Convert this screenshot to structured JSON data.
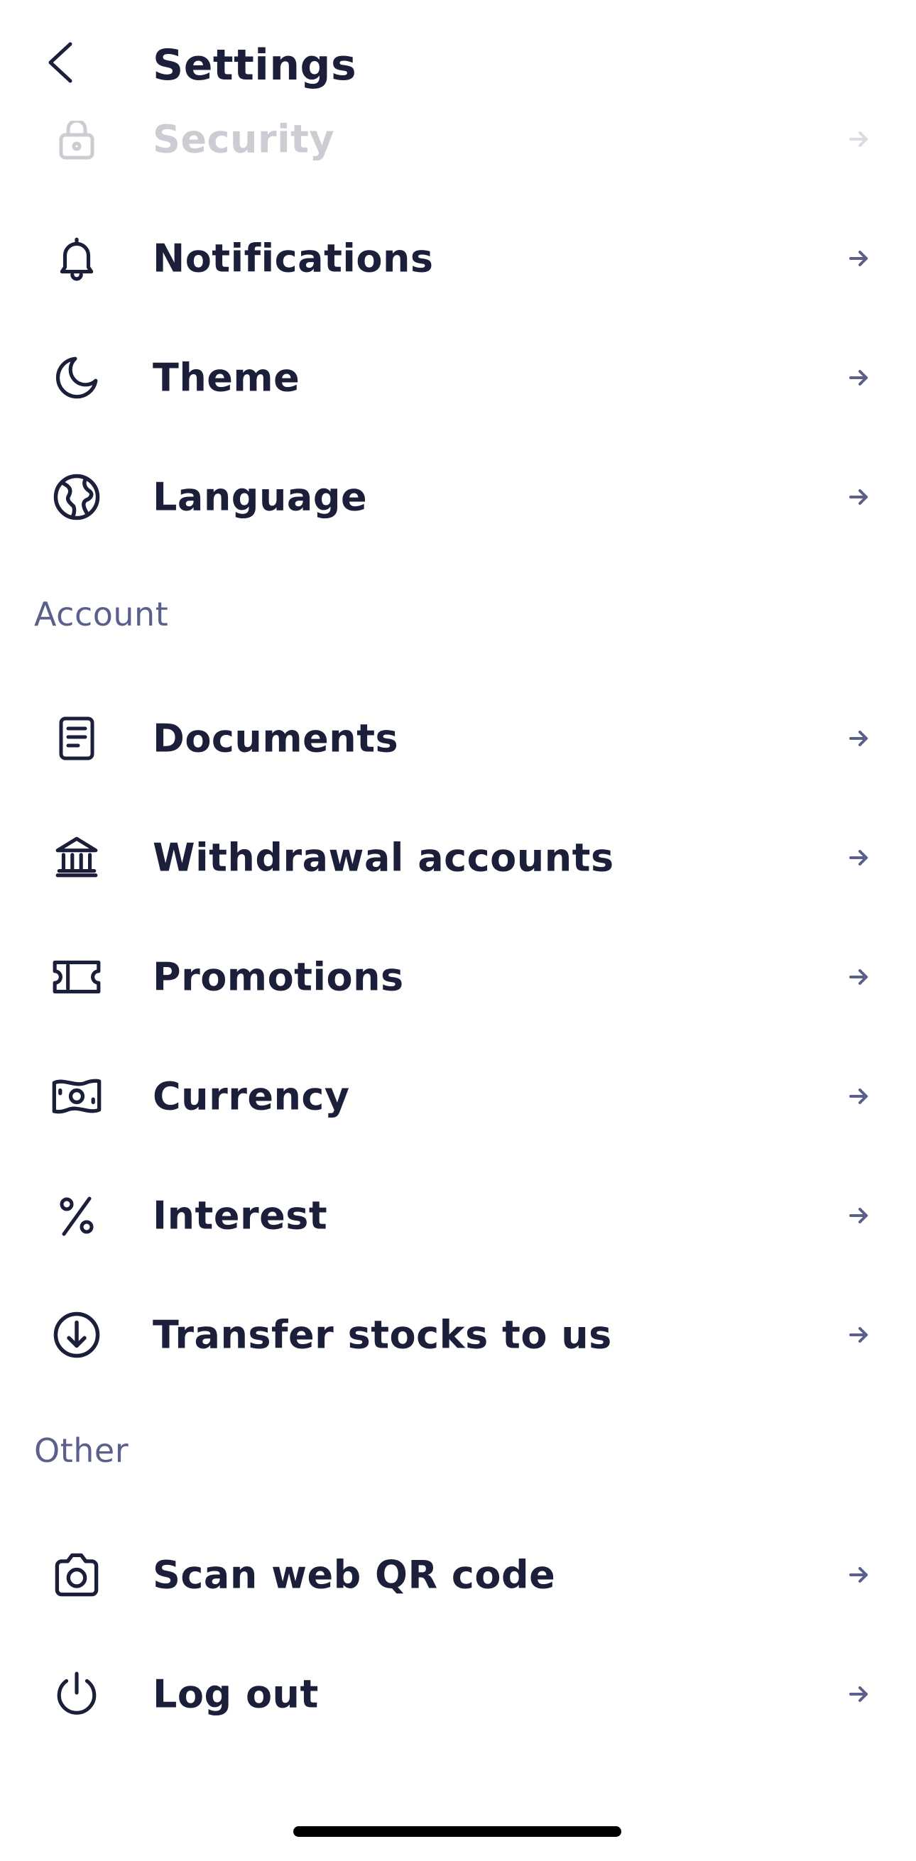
{
  "header": {
    "title": "Settings"
  },
  "general": {
    "items": [
      {
        "label": "Security",
        "icon": "lock-icon"
      },
      {
        "label": "Notifications",
        "icon": "bell-icon"
      },
      {
        "label": "Theme",
        "icon": "moon-icon"
      },
      {
        "label": "Language",
        "icon": "globe-icon"
      }
    ]
  },
  "account": {
    "section_label": "Account",
    "items": [
      {
        "label": "Documents",
        "icon": "document-icon"
      },
      {
        "label": "Withdrawal accounts",
        "icon": "bank-icon"
      },
      {
        "label": "Promotions",
        "icon": "ticket-icon"
      },
      {
        "label": "Currency",
        "icon": "banknote-icon"
      },
      {
        "label": "Interest",
        "icon": "percent-icon"
      },
      {
        "label": "Transfer stocks to us",
        "icon": "arrow-down-circle-icon"
      }
    ]
  },
  "other": {
    "section_label": "Other",
    "items": [
      {
        "label": "Scan web QR code",
        "icon": "camera-icon"
      },
      {
        "label": "Log out",
        "icon": "power-icon"
      }
    ]
  },
  "colors": {
    "text": "#1c1f3a",
    "section_header": "#5a5f8c",
    "arrow": "#5a5f8c",
    "background": "#ffffff"
  }
}
